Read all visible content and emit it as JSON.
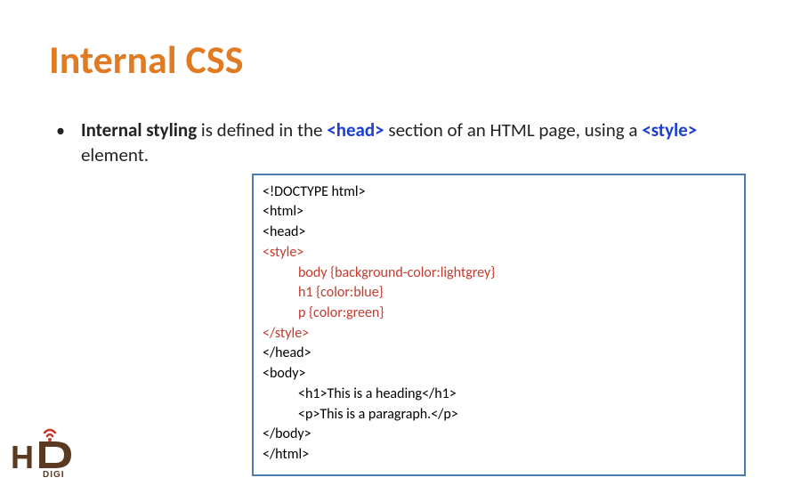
{
  "title": "Internal CSS",
  "bullet": {
    "strong": "Internal styling",
    "text1": " is defined in the ",
    "tag1": "<head>",
    "text2": " section of an HTML page, using a ",
    "tag2": "<style>",
    "text3": " element."
  },
  "code": {
    "l1": "<!DOCTYPE html>",
    "l2": "<html>",
    "l3": "<head>",
    "l4": "<style>",
    "l5": "body {background-color:lightgrey}",
    "l6": "h1   {color:blue}",
    "l7": "p    {color:green}",
    "l8": "</style>",
    "l9": "</head>",
    "l10": "<body>",
    "l11": "<h1>This is a heading</h1>",
    "l12": "<p>This is a paragraph.</p>",
    "l13": "</body>",
    "l14": "</html>"
  },
  "logo": {
    "text": "DIGI"
  }
}
